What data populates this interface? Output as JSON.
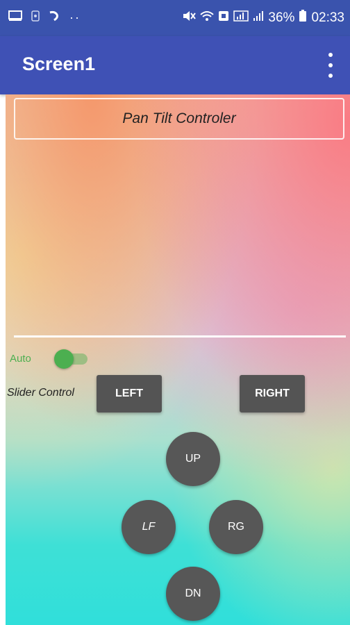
{
  "status_bar": {
    "battery": "36%",
    "time": "02:33"
  },
  "app_bar": {
    "title": "Screen1"
  },
  "content": {
    "title": "Pan Tilt Controler",
    "auto_label": "Auto",
    "auto_enabled": true,
    "slider_label": "Slider Control",
    "buttons": {
      "left": "LEFT",
      "right": "RIGHT",
      "up": "UP",
      "lf": "LF",
      "rg": "RG",
      "dn": "DN"
    }
  },
  "colors": {
    "app_bar": "#3f51b5",
    "status_bar": "#3a53ad",
    "accent_green": "#4caf50",
    "button": "#545454"
  }
}
